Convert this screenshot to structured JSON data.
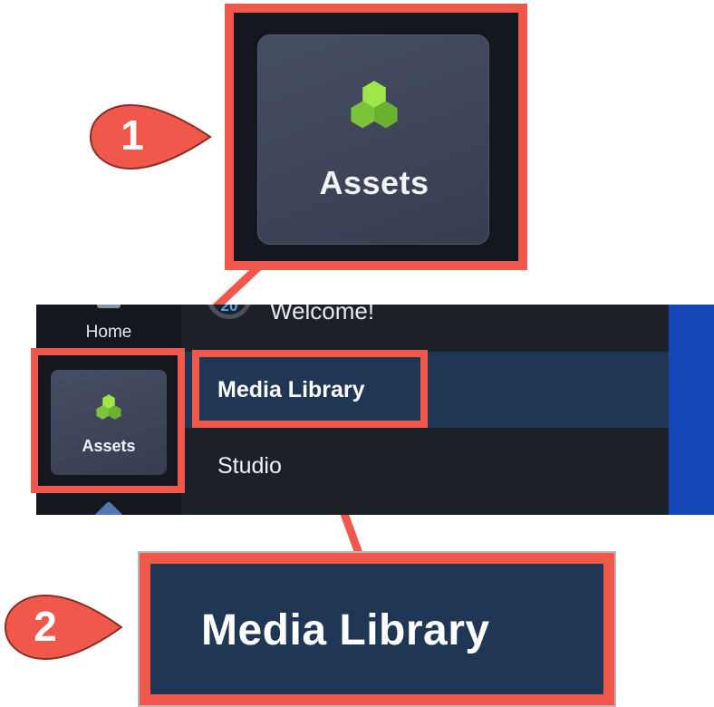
{
  "colors": {
    "annotation": "#f0584b",
    "rail_bg": "#14171e",
    "menu_bg": "#1c2029",
    "selected_item_bg": "#1f3654",
    "accent_blue": "#1546b8",
    "asset_icon_green": "#8ad93a"
  },
  "sidebar": {
    "items": [
      {
        "label": "Home",
        "icon": "home-icon"
      },
      {
        "label": "Assets",
        "icon": "assets-cubes-icon",
        "selected": true
      }
    ]
  },
  "menu": {
    "welcome": {
      "label": "Welcome!",
      "avatar_text": "20"
    },
    "items": [
      {
        "label": "Media Library",
        "selected": true
      },
      {
        "label": "Studio"
      }
    ]
  },
  "callouts": [
    {
      "number": "1",
      "label": "Assets"
    },
    {
      "number": "2",
      "label": "Media Library"
    }
  ]
}
